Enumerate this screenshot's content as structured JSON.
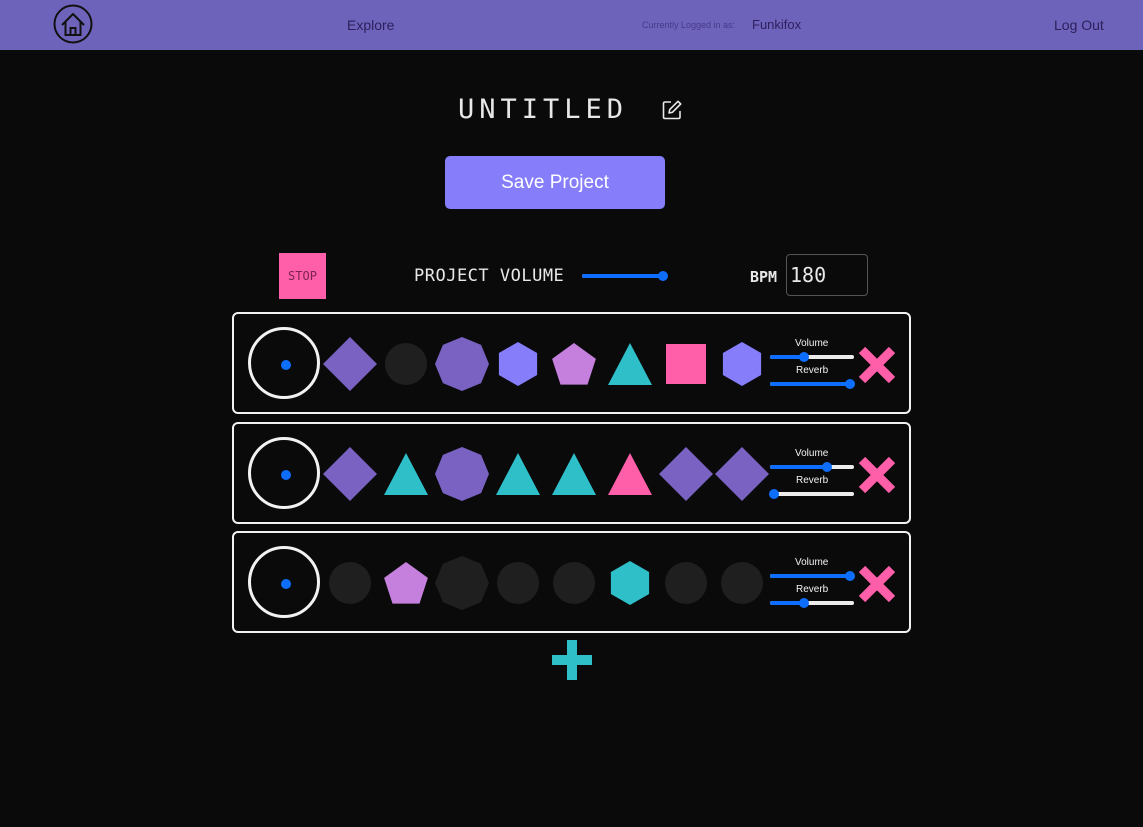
{
  "nav": {
    "explore": "Explore",
    "login_label": "Currently Logged in as:",
    "username": "Funkifox",
    "logout": "Log Out"
  },
  "project": {
    "title": "UNTITLED",
    "save_label": "Save Project"
  },
  "controls": {
    "stop_label": "STOP",
    "project_volume_label": "PROJECT VOLUME",
    "project_volume": 0.97,
    "bpm_label": "BPM",
    "bpm_value": "180"
  },
  "colors": {
    "purple": "#7a62c2",
    "lilac": "#c480dc",
    "periwinkle": "#857df9",
    "teal": "#2ebfc9",
    "pink": "#ff5ea8",
    "empty": "#1f1f1f",
    "nav": "#6e63bb",
    "slider": "#0d6efd"
  },
  "tracks": [
    {
      "volume_label": "Volume",
      "volume": 0.4,
      "reverb_label": "Reverb",
      "reverb": 0.95,
      "steps": [
        {
          "shape": "diamond",
          "color": "purple"
        },
        {
          "shape": "circle",
          "color": "empty"
        },
        {
          "shape": "octagon",
          "color": "purple"
        },
        {
          "shape": "hexagon",
          "color": "periwinkle"
        },
        {
          "shape": "pentagon",
          "color": "lilac"
        },
        {
          "shape": "triangle",
          "color": "teal"
        },
        {
          "shape": "square",
          "color": "pink"
        },
        {
          "shape": "hexagon",
          "color": "periwinkle"
        }
      ]
    },
    {
      "volume_label": "Volume",
      "volume": 0.68,
      "reverb_label": "Reverb",
      "reverb": 0.05,
      "steps": [
        {
          "shape": "diamond",
          "color": "purple"
        },
        {
          "shape": "triangle",
          "color": "teal"
        },
        {
          "shape": "octagon",
          "color": "purple"
        },
        {
          "shape": "triangle",
          "color": "teal"
        },
        {
          "shape": "triangle",
          "color": "teal"
        },
        {
          "shape": "triangle",
          "color": "pink"
        },
        {
          "shape": "diamond",
          "color": "purple"
        },
        {
          "shape": "diamond",
          "color": "purple"
        }
      ]
    },
    {
      "volume_label": "Volume",
      "volume": 0.95,
      "reverb_label": "Reverb",
      "reverb": 0.4,
      "steps": [
        {
          "shape": "circle",
          "color": "empty"
        },
        {
          "shape": "pentagon",
          "color": "lilac"
        },
        {
          "shape": "octagon",
          "color": "empty"
        },
        {
          "shape": "circle",
          "color": "empty"
        },
        {
          "shape": "circle",
          "color": "empty"
        },
        {
          "shape": "hexagon",
          "color": "teal"
        },
        {
          "shape": "circle",
          "color": "empty"
        },
        {
          "shape": "circle",
          "color": "empty"
        }
      ]
    }
  ]
}
